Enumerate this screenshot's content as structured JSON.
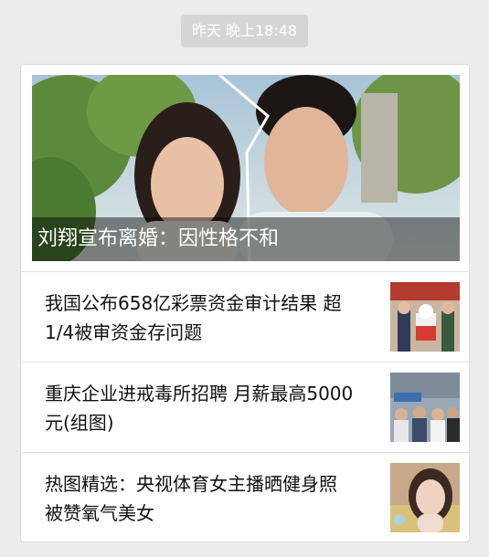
{
  "timestamp": "昨天 晚上18:48",
  "hero": {
    "caption": "刘翔宣布离婚：因性格不和",
    "image": "hero-photo"
  },
  "items": [
    {
      "title": "我国公布658亿彩票资金审计结果 超1/4被审资金存问题",
      "thumb": "lottery-event-thumb"
    },
    {
      "title": "重庆企业进戒毒所招聘 月薪最高5000元(组图)",
      "thumb": "job-fair-thumb"
    },
    {
      "title": "热图精选：央视体育女主播晒健身照 被赞氧气美女",
      "thumb": "anchor-portrait-thumb"
    }
  ],
  "colors": {
    "background": "#ececec",
    "card": "#ffffff",
    "timestamp_bg": "#d5d5d5",
    "caption_overlay": "rgba(0,0,0,0.45)"
  }
}
